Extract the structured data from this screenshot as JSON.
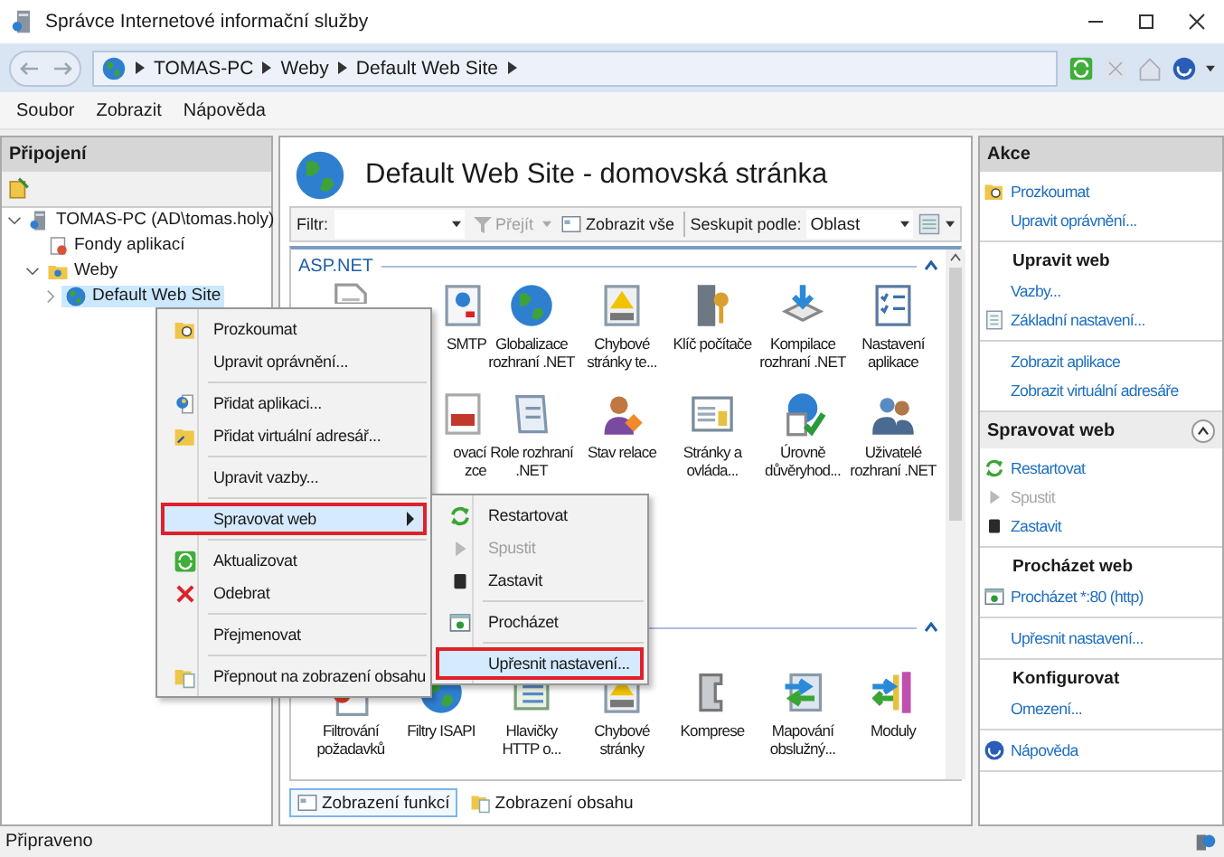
{
  "window": {
    "title": "Správce Internetové informační služby"
  },
  "breadcrumb": [
    "TOMAS-PC",
    "Weby",
    "Default Web Site"
  ],
  "menu": [
    "Soubor",
    "Zobrazit",
    "Nápověda"
  ],
  "connections": {
    "title": "Připojení",
    "tree": [
      {
        "label": "TOMAS-PC (AD\\tomas.holy)",
        "expanded": true,
        "selected": false,
        "children": [
          {
            "label": "Fondy aplikací",
            "selected": false
          },
          {
            "label": "Weby",
            "expanded": true,
            "selected": false,
            "children": [
              {
                "label": "Default Web Site",
                "expanded": false,
                "selected": true
              }
            ]
          }
        ]
      }
    ]
  },
  "page": {
    "title": "Default Web Site - domovská stránka",
    "filter": {
      "label": "Filtr:",
      "go": "Přejít",
      "show_all": "Zobrazit vše",
      "group_by": "Seskupit podle:",
      "group_value": "Oblast"
    },
    "groups": [
      {
        "title": "ASP.NET",
        "expanded": true,
        "items": [
          {
            "kind": "feature"
          },
          {
            "kind": "feature",
            "label": "SMTP",
            "partial": true
          },
          {
            "kind": "feature",
            "label": "Globalizace\nrozhraní .NET"
          },
          {
            "kind": "feature",
            "label": "Chybové\nstránky te..."
          },
          {
            "kind": "feature",
            "label": "Klíč počítače"
          },
          {
            "kind": "feature",
            "label": "Kompilace\nrozhraní .NET"
          },
          {
            "kind": "feature",
            "label": "Nastavení\naplikace"
          },
          {
            "kind": "covered"
          },
          {
            "kind": "feature",
            "label": "ovací\nzce",
            "partial": true
          },
          {
            "kind": "feature",
            "label": "Role rozhraní\n.NET"
          },
          {
            "kind": "feature",
            "label": "Stav relace"
          },
          {
            "kind": "feature",
            "label": "Stránky a\novláda..."
          },
          {
            "kind": "feature",
            "label": "Úrovně\ndůvěryhod..."
          },
          {
            "kind": "feature",
            "label": "Uživatelé\nrozhraní .NET"
          }
        ]
      },
      {
        "expanded": true,
        "items": [
          {
            "kind": "feature",
            "label": "Filtrování\npožadavků"
          },
          {
            "kind": "feature",
            "label": "Filtry ISAPI"
          },
          {
            "kind": "feature",
            "label": "Hlavičky\nHTTP o..."
          },
          {
            "kind": "feature",
            "label": "Chybové\nstránky"
          },
          {
            "kind": "feature",
            "label": "Komprese"
          },
          {
            "kind": "feature",
            "label": "Mapování\nobslužný..."
          },
          {
            "kind": "feature",
            "label": "Moduly"
          }
        ]
      }
    ]
  },
  "view_tabs": [
    {
      "label": "Zobrazení funkcí",
      "selected": true
    },
    {
      "label": "Zobrazení obsahu",
      "selected": false
    }
  ],
  "actions": {
    "title": "Akce",
    "sections": [
      {
        "items": [
          {
            "label": "Prozkoumat",
            "disabled": false
          },
          {
            "label": "Upravit oprávnění...",
            "disabled": false
          }
        ]
      },
      {
        "title": "Upravit web",
        "items": [
          {
            "label": "Vazby...",
            "disabled": false
          },
          {
            "label": "Základní nastavení...",
            "disabled": false
          }
        ]
      },
      {
        "items": [
          {
            "label": "Zobrazit aplikace",
            "disabled": false
          },
          {
            "label": "Zobrazit virtuální adresáře",
            "disabled": false
          }
        ]
      }
    ],
    "panel": {
      "title": "Spravovat web",
      "expanded": true,
      "sections": [
        {
          "items": [
            {
              "label": "Restartovat",
              "disabled": false
            },
            {
              "label": "Spustit",
              "disabled": true
            },
            {
              "label": "Zastavit",
              "disabled": false
            }
          ]
        },
        {
          "title": "Procházet web",
          "items": [
            {
              "label": "Procházet *:80 (http)",
              "disabled": false
            }
          ]
        },
        {
          "items": [
            {
              "label": "Upřesnit nastavení...",
              "disabled": false
            }
          ]
        },
        {
          "title": "Konfigurovat",
          "items": [
            {
              "label": "Omezení...",
              "disabled": false
            }
          ]
        },
        {
          "items": [
            {
              "label": "Nápověda",
              "disabled": false
            }
          ]
        }
      ]
    }
  },
  "context_menu": {
    "items": [
      {
        "kind": "item",
        "label": "Prozkoumat",
        "selected": false
      },
      {
        "kind": "item",
        "label": "Upravit oprávnění...",
        "selected": false
      },
      {
        "kind": "separator"
      },
      {
        "kind": "item",
        "label": "Přidat aplikaci...",
        "selected": false
      },
      {
        "kind": "item",
        "label": "Přidat virtuální adresář...",
        "selected": false
      },
      {
        "kind": "separator"
      },
      {
        "kind": "item",
        "label": "Upravit vazby...",
        "selected": false
      },
      {
        "kind": "separator"
      },
      {
        "kind": "item",
        "label": "Spravovat web",
        "selected": true,
        "submenu": true
      },
      {
        "kind": "separator"
      },
      {
        "kind": "item",
        "label": "Aktualizovat",
        "selected": false
      },
      {
        "kind": "item",
        "label": "Odebrat",
        "selected": false
      },
      {
        "kind": "separator"
      },
      {
        "kind": "item",
        "label": "Přejmenovat",
        "selected": false
      },
      {
        "kind": "separator"
      },
      {
        "kind": "item",
        "label": "Přepnout na zobrazení obsahu",
        "selected": false
      }
    ]
  },
  "submenu": {
    "items": [
      {
        "kind": "item",
        "label": "Restartovat",
        "selected": false,
        "disabled": false
      },
      {
        "kind": "item",
        "label": "Spustit",
        "selected": false,
        "disabled": true
      },
      {
        "kind": "item",
        "label": "Zastavit",
        "selected": false,
        "disabled": false
      },
      {
        "kind": "separator"
      },
      {
        "kind": "item",
        "label": "Procházet",
        "selected": false,
        "disabled": false
      },
      {
        "kind": "separator"
      },
      {
        "kind": "item",
        "label": "Upřesnit nastavení...",
        "selected": true,
        "disabled": false
      }
    ]
  },
  "status_bar": {
    "text": "Připraveno"
  }
}
